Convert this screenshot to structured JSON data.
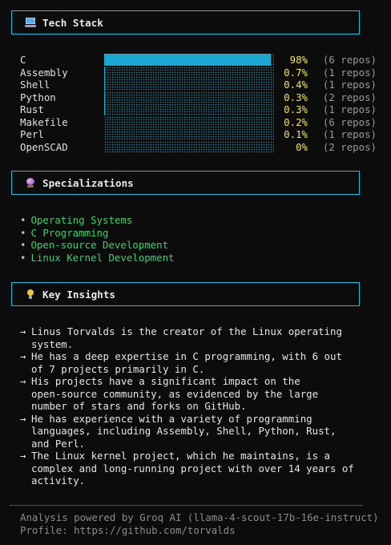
{
  "sections": {
    "tech_stack": {
      "title": "Tech Stack",
      "icon": "laptop-icon"
    },
    "specializations": {
      "title": "Specializations",
      "icon": "crystal-ball-icon"
    },
    "insights": {
      "title": "Key Insights",
      "icon": "light-bulb-icon"
    }
  },
  "languages": [
    {
      "name": "C",
      "percent": "98%",
      "repos": "(6 repos)",
      "share": 0.98
    },
    {
      "name": "Assembly",
      "percent": "0.7%",
      "repos": "(1 repos)",
      "share": 0.007
    },
    {
      "name": "Shell",
      "percent": "0.4%",
      "repos": "(1 repos)",
      "share": 0.004
    },
    {
      "name": "Python",
      "percent": "0.3%",
      "repos": "(2 repos)",
      "share": 0.003
    },
    {
      "name": "Rust",
      "percent": "0.3%",
      "repos": "(1 repos)",
      "share": 0.003
    },
    {
      "name": "Makefile",
      "percent": "0.2%",
      "repos": "(6 repos)",
      "share": 0.002
    },
    {
      "name": "Perl",
      "percent": "0.1%",
      "repos": "(1 repos)",
      "share": 0.001
    },
    {
      "name": "OpenSCAD",
      "percent": "0%",
      "repos": "(2 repos)",
      "share": 0.0
    }
  ],
  "colors": {
    "accent": "#29b6d8",
    "bar_fill": "#1aa7d0",
    "percent": "#f2e35a",
    "specialization": "#3fcf6a"
  },
  "specializations": [
    "Operating Systems",
    "C Programming",
    "Open-source Development",
    "Linux Kernel Development"
  ],
  "bullet": "•",
  "arrow": "→",
  "insights": [
    "Linus Torvalds is the creator of the Linux operating\nsystem.",
    "He has a deep expertise in C programming, with 6 out\nof 7 projects primarily in C.",
    "His projects have a significant impact on the\nopen-source community, as evidenced by the large\nnumber of stars and forks on GitHub.",
    "He has experience with a variety of programming\nlanguages, including Assembly, Shell, Python, Rust,\nand Perl.",
    "The Linux kernel project, which he maintains, is a\ncomplex and long-running project with over 14 years of\nactivity."
  ],
  "footer": {
    "powered_by": "Analysis powered by Groq AI (llama-4-scout-17b-16e-instruct)",
    "profile": "Profile: https://github.com/torvalds"
  }
}
